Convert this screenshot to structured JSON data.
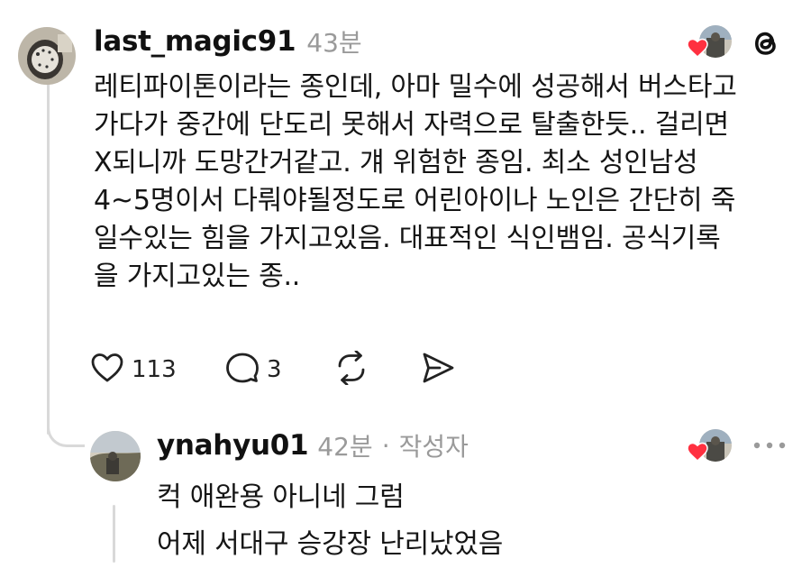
{
  "post": {
    "username": "last_magic91",
    "time": "43분",
    "body_lines": [
      "레티파이톤이라는 종인데, 아마 밀수에 성공해서 버스타고",
      "가다가 중간에 단도리 못해서 자력으로 탈출한듯.. 걸리면",
      "X되니까 도망간거같고. 걔 위험한 종임. 최소 성인남성",
      "4~5명이서 다뤄야될정도로 어린아이나 노인은 간단히 죽",
      "일수있는 힘을 가지고있음. 대표적인 식인뱀임. 공식기록",
      "을 가지고있는 종.."
    ],
    "likes": "113",
    "replies": "3"
  },
  "reply": {
    "username": "ynahyu01",
    "time": "42분",
    "separator": "·",
    "author_badge": "작성자",
    "body_lines": [
      "컥 애완용 아니네 그럼",
      "어제 서대구 승강장 난리났었음"
    ]
  },
  "colors": {
    "heart_red": "#ff3040",
    "muted": "#9a9a9a",
    "text": "#111111"
  },
  "icons": [
    "threads-logo-icon",
    "heart-icon",
    "comment-icon",
    "repost-icon",
    "share-icon",
    "more-icon"
  ]
}
